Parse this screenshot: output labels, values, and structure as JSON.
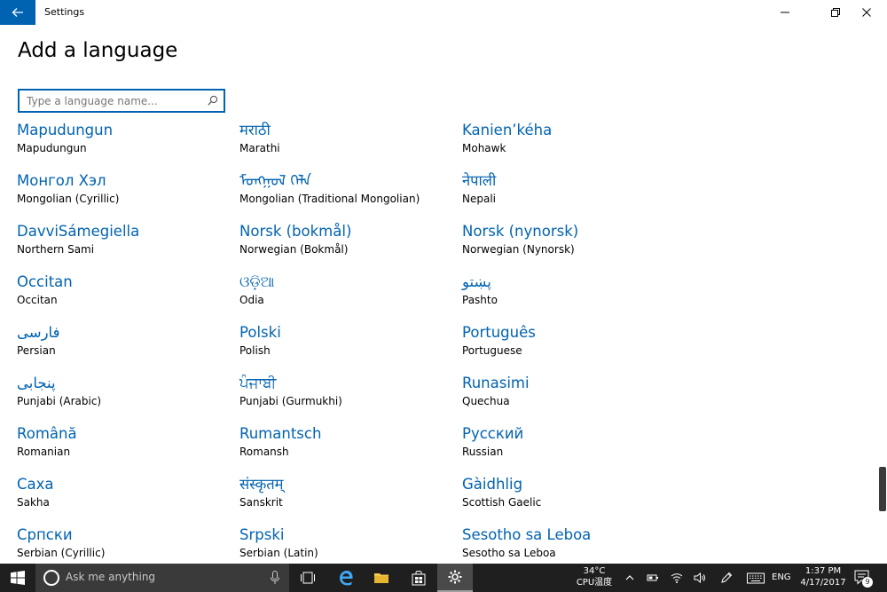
{
  "window": {
    "title": "Settings"
  },
  "page": {
    "title": "Add a language"
  },
  "search": {
    "placeholder": "Type a language name...",
    "value": ""
  },
  "languages": [
    {
      "native": "Mapudungun",
      "english": "Mapudungun"
    },
    {
      "native": "मराठी",
      "english": "Marathi"
    },
    {
      "native": "Kanien’kéha",
      "english": "Mohawk"
    },
    {
      "native": "Монгол Хэл",
      "english": "Mongolian (Cyrillic)"
    },
    {
      "native": "ᠮᠣᠩᠭᠣᠯ ᠬᠡᠯᠡ",
      "english": "Mongolian (Traditional Mongolian)"
    },
    {
      "native": "नेपाली",
      "english": "Nepali"
    },
    {
      "native": "DavviSámegiella",
      "english": "Northern Sami"
    },
    {
      "native": "Norsk (bokmål)",
      "english": "Norwegian (Bokmål)"
    },
    {
      "native": "Norsk (nynorsk)",
      "english": "Norwegian (Nynorsk)"
    },
    {
      "native": "Occitan",
      "english": "Occitan"
    },
    {
      "native": "ଓଡ଼ିଆ",
      "english": "Odia"
    },
    {
      "native": "پښتو",
      "english": "Pashto"
    },
    {
      "native": "فارسی",
      "english": "Persian"
    },
    {
      "native": "Polski",
      "english": "Polish"
    },
    {
      "native": "Português",
      "english": "Portuguese"
    },
    {
      "native": "پنجابی",
      "english": "Punjabi (Arabic)"
    },
    {
      "native": "ਪੰਜਾਬੀ",
      "english": "Punjabi (Gurmukhi)"
    },
    {
      "native": "Runasimi",
      "english": "Quechua"
    },
    {
      "native": "Română",
      "english": "Romanian"
    },
    {
      "native": "Rumantsch",
      "english": "Romansh"
    },
    {
      "native": "Русский",
      "english": "Russian"
    },
    {
      "native": "Саха",
      "english": "Sakha"
    },
    {
      "native": "संस्कृतम्",
      "english": "Sanskrit"
    },
    {
      "native": "Gàidhlig",
      "english": "Scottish Gaelic"
    },
    {
      "native": "Српски",
      "english": "Serbian (Cyrillic)"
    },
    {
      "native": "Srpski",
      "english": "Serbian (Latin)"
    },
    {
      "native": "Sesotho sa Leboa",
      "english": "Sesotho sa Leboa"
    }
  ],
  "taskbar": {
    "search_placeholder": "Ask me anything",
    "temperature": "34°C",
    "temperature_label": "CPU温度",
    "input_language": "ENG",
    "time": "1:37 PM",
    "date": "4/17/2017",
    "notification_count": "9"
  },
  "colors": {
    "accent": "#0063b1",
    "taskbar": "#1f1f1f"
  }
}
